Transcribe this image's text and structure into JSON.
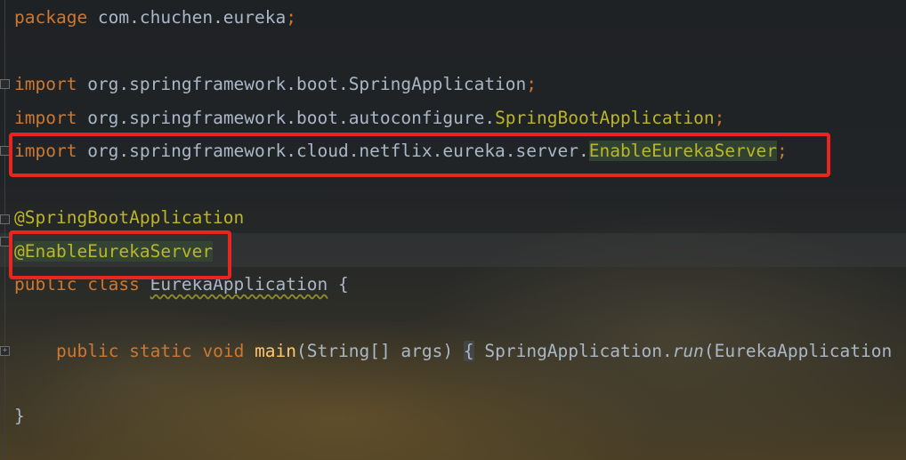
{
  "editor": {
    "lines": {
      "package": {
        "keyword": "package",
        "name": " com.chuchen.eureka",
        "semicolon": ";"
      },
      "import1": {
        "keyword": "import",
        "path": " org.springframework.boot.SpringApplication",
        "semicolon": ";"
      },
      "import2": {
        "keyword": "import",
        "path": " org.springframework.boot.autoconfigure.",
        "cls": "SpringBootApplication",
        "semicolon": ";"
      },
      "import3": {
        "keyword": "import",
        "path": " org.springframework.cloud.netflix.eureka.server.",
        "cls": "EnableEurekaServer",
        "semicolon": ";"
      },
      "annotation1": "@SpringBootApplication",
      "annotation2": "@EnableEurekaServer",
      "class_decl": {
        "mod": "public",
        "kw": " class ",
        "name": "EurekaApplication",
        "brace": " {"
      },
      "main": {
        "mods": "public static void ",
        "name": "main",
        "params": "(String[] args) ",
        "brace": "{",
        "body_pre": " SpringApplication.",
        "run": "run",
        "body_post": "(EurekaApplication"
      },
      "closing": "}"
    }
  },
  "highlight_color": "#e8251f"
}
